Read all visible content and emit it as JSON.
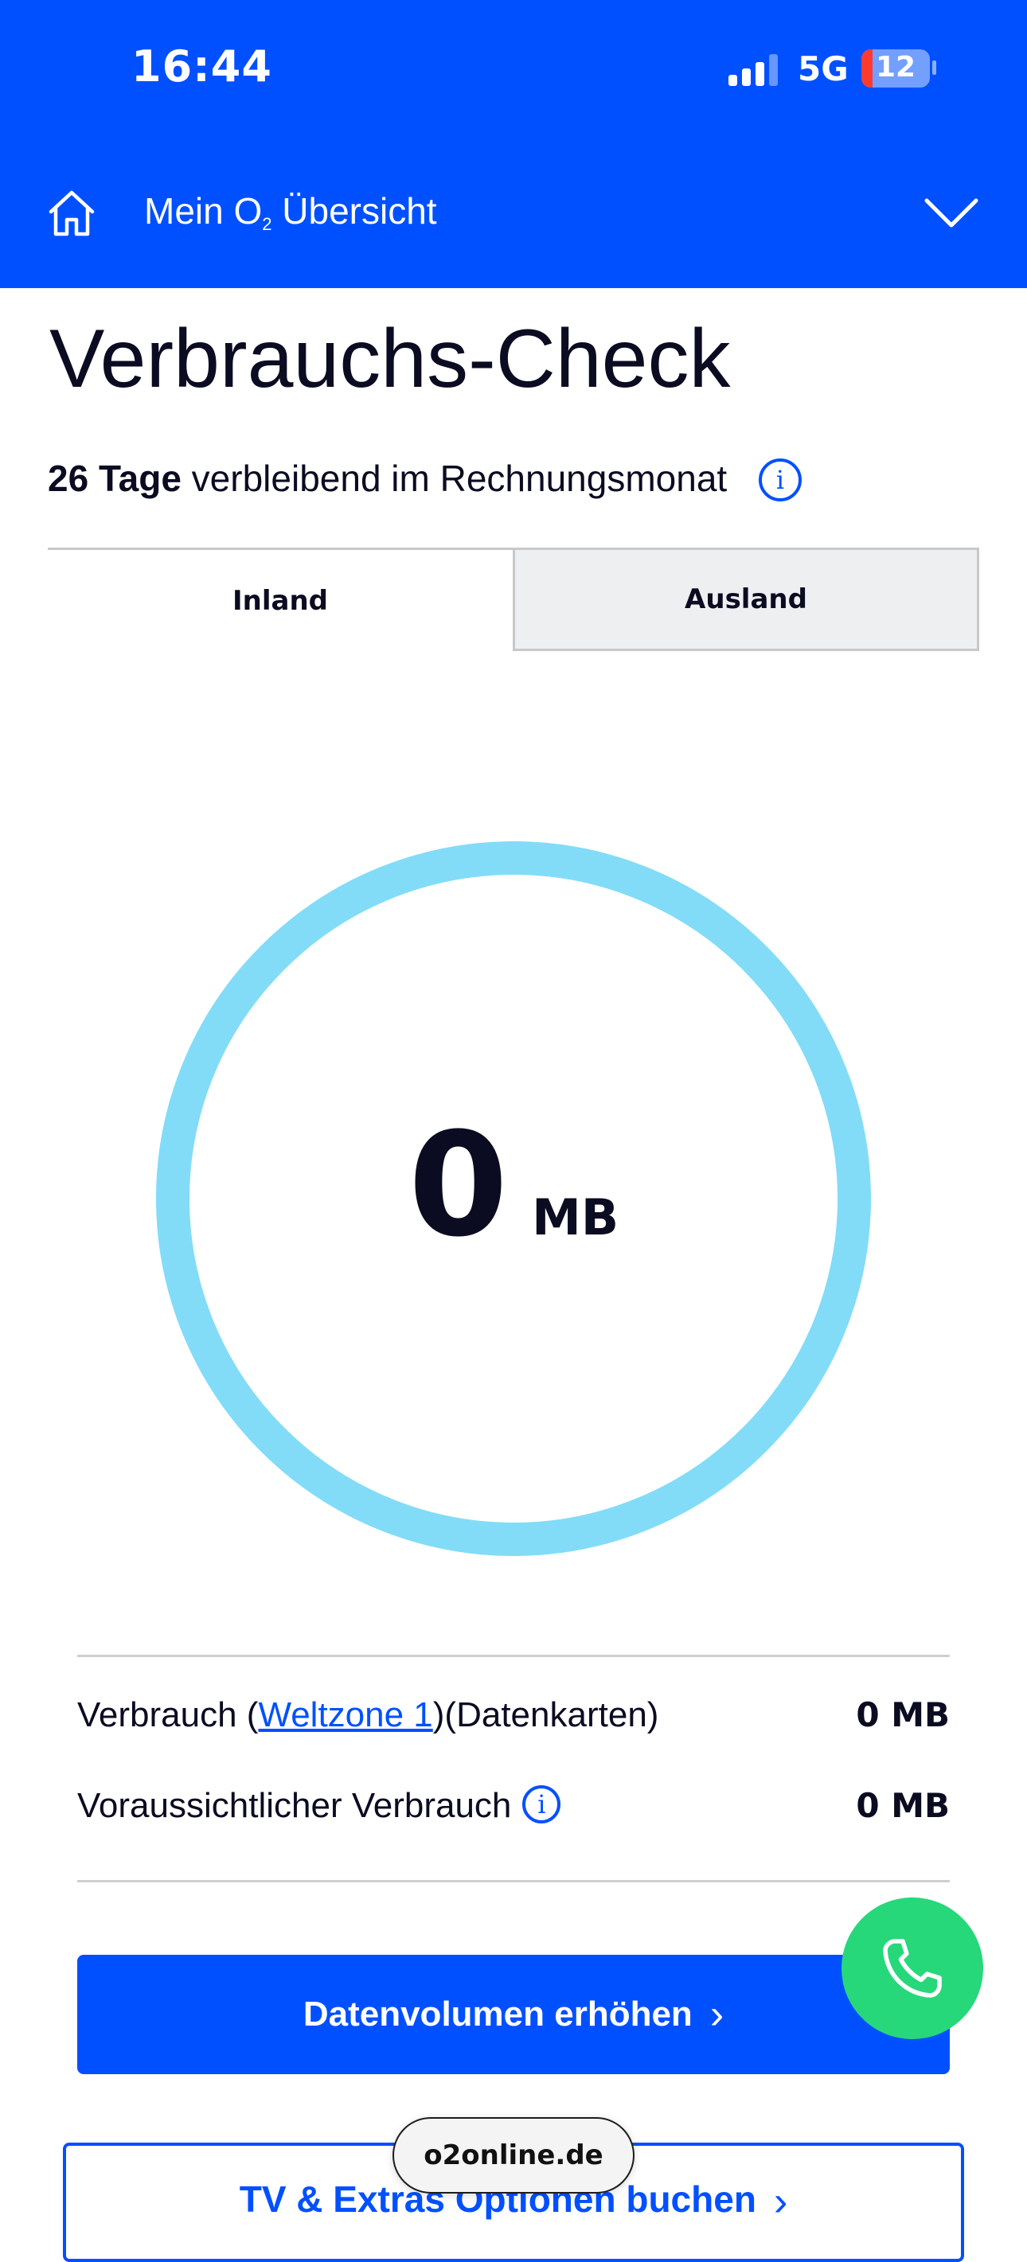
{
  "status_bar": {
    "time": "16:44",
    "network": "5G",
    "battery": "12",
    "signal_bars_active": 3
  },
  "header": {
    "title_prefix": "Mein O",
    "title_sub": "2",
    "title_suffix": " Übersicht"
  },
  "page": {
    "title": "Verbrauchs-Check",
    "days_bold": "26 Tage",
    "days_text": " verbleibend im Rechnungsmonat"
  },
  "tabs": [
    {
      "label": "Inland",
      "active": true
    },
    {
      "label": "Ausland",
      "active": false
    }
  ],
  "gauge": {
    "value": "0",
    "unit": "MB",
    "ring_color": "#82dcf8"
  },
  "usage": {
    "row1": {
      "label_prefix": "Verbrauch (",
      "link": "Weltzone 1",
      "label_suffix": ")(Datenkarten)",
      "value": "0 MB"
    },
    "row2": {
      "label": "Voraussichtlicher Verbrauch",
      "value": "0 MB"
    }
  },
  "buttons": {
    "primary": "Datenvolumen erhöhen",
    "secondary": "TV & Extras Optionen buchen",
    "chevron": "›"
  },
  "info_glyph": "i",
  "browser": {
    "url": "o2online.de"
  },
  "colors": {
    "brand_blue": "#0050ff",
    "call_green": "#26d87a"
  }
}
